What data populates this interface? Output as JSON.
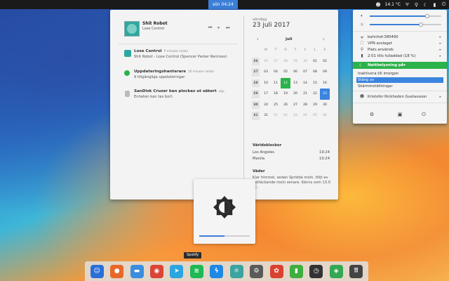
{
  "topbar": {
    "clock": "sön 04:24",
    "temperature": "14.1 °C",
    "tray_icons": [
      "user-icon",
      "network-icon",
      "location-icon",
      "moon-icon",
      "battery-icon",
      "power-icon"
    ]
  },
  "notifications": {
    "media": {
      "title": "Shit Robot",
      "subtitle": "Lose Control",
      "controls": [
        "⏮",
        "⏸",
        "⏭"
      ]
    },
    "items": [
      {
        "title": "Lose Control",
        "time": "9 minuter sedan",
        "body": "Shit Robot - Lose Control (Spencer Parker Remixes)",
        "icon": "music-icon",
        "color": "#2fa7a0"
      },
      {
        "title": "Uppdateringshanterare",
        "time": "16 minuter sedan",
        "body": "9 tillgängliga uppdateringar",
        "icon": "update-icon",
        "color": "#2cb24a"
      },
      {
        "title": "SanDisk Cruzer kan plockas ut säkert",
        "time": "upp",
        "body": "Enheten kan tas bort.",
        "icon": "usb-icon",
        "color": "#bbbbbb"
      }
    ]
  },
  "calendar": {
    "weekday": "söndag",
    "date": "23 juli 2017",
    "month": "juli",
    "prev": "‹",
    "next": "›",
    "headers": [
      "M",
      "T",
      "O",
      "T",
      "F",
      "L",
      "S"
    ],
    "weeks": [
      {
        "wk": "26",
        "days": [
          "26",
          "27",
          "28",
          "29",
          "30",
          "01",
          "02"
        ]
      },
      {
        "wk": "27",
        "days": [
          "03",
          "04",
          "05",
          "06",
          "07",
          "08",
          "09"
        ]
      },
      {
        "wk": "28",
        "days": [
          "10",
          "11",
          "12",
          "13",
          "14",
          "15",
          "16"
        ]
      },
      {
        "wk": "29",
        "days": [
          "17",
          "18",
          "19",
          "20",
          "21",
          "22",
          "23"
        ]
      },
      {
        "wk": "30",
        "days": [
          "24",
          "25",
          "26",
          "27",
          "28",
          "29",
          "30"
        ]
      },
      {
        "wk": "31",
        "days": [
          "31",
          "01",
          "02",
          "03",
          "04",
          "05",
          "06"
        ]
      }
    ],
    "today": "12",
    "selected": "23",
    "world_clocks_title": "Världsklockor",
    "world_clocks": [
      {
        "city": "Los Angeles",
        "time": "19:24"
      },
      {
        "city": "Manila",
        "time": "10:24"
      }
    ],
    "weather_title": "Väder",
    "weather_text": "Klar himmel, sedan Spridda moln, följt av Heltäckande moln senare. Känns som 13.0 °C."
  },
  "osd": {
    "icon": "brightness-icon",
    "level": 0.5
  },
  "tooltip": "Spotify",
  "dock": [
    {
      "name": "finder-icon",
      "color": "#2a6fd8",
      "glyph": "☺"
    },
    {
      "name": "firefox-icon",
      "color": "#e8682a",
      "glyph": "●"
    },
    {
      "name": "files-icon",
      "color": "#3b8de0",
      "glyph": "▬"
    },
    {
      "name": "chrome-icon",
      "color": "#db4437",
      "glyph": "◉"
    },
    {
      "name": "telegram-icon",
      "color": "#2ca5e0",
      "glyph": "➤"
    },
    {
      "name": "spotify-icon",
      "color": "#1db954",
      "glyph": "≋"
    },
    {
      "name": "messenger-icon",
      "color": "#1e88e5",
      "glyph": "ϟ"
    },
    {
      "name": "atom-icon",
      "color": "#3aa5a0",
      "glyph": "⚛"
    },
    {
      "name": "settings-icon",
      "color": "#5a5a5a",
      "glyph": "⚙"
    },
    {
      "name": "rawtherapee-icon",
      "color": "#d9432f",
      "glyph": "✿"
    },
    {
      "name": "archive-icon",
      "color": "#3fae3f",
      "glyph": "▮"
    },
    {
      "name": "clock-icon",
      "color": "#333333",
      "glyph": "◷"
    },
    {
      "name": "maps-icon",
      "color": "#34a853",
      "glyph": "◈"
    },
    {
      "name": "app-grid-icon",
      "color": "#444444",
      "glyph": "⠿"
    }
  ],
  "system_menu": {
    "volume_level": 0.8,
    "brightness_level": 0.72,
    "network": "bahnhof-380490",
    "vpn": "VPN avslaget",
    "location": "Plats används",
    "battery": "2:01 tills fulladdad (18 %)",
    "night_light": "Nattbelysning på",
    "night_sub": [
      "Inaktivera till imorgon",
      "Stäng av",
      "Skärminställningar"
    ],
    "night_selected_index": 1,
    "user": "Kristofer Rickheden Gustavsson",
    "accent": "#2cb24a",
    "highlight": "#3b84e0"
  }
}
